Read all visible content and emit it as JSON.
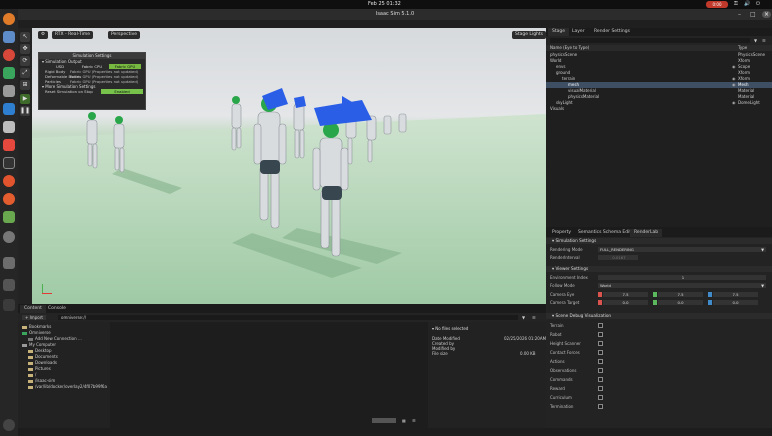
{
  "system": {
    "clock": "Feb 25 01:32",
    "rec_label": "0:00",
    "indicators": [
      "⚿",
      "🔊",
      "⏻"
    ]
  },
  "window": {
    "title": "Isaac Sim 5.1.0"
  },
  "menu": [
    "File",
    "Edit",
    "Create",
    "Window",
    "Tools",
    "Utilities",
    "Layouts",
    "Help"
  ],
  "viewport": {
    "render_mode": "RTX - Real-Time",
    "camera": "Perspective",
    "lights": "Stage Lights"
  },
  "sim_panel": {
    "title": "Simulation Settings",
    "section_output": "Simulation Output",
    "devices": [
      "USD",
      "Fabric CPU",
      "Fabric GPU"
    ],
    "selected_device": "Fabric GPU",
    "rows": [
      {
        "label": "Rigid Body",
        "value": "Fabric GPU (Properties not updated)"
      },
      {
        "label": "Deformable Bodies",
        "value": "Fabric GPU (Properties not updated)"
      },
      {
        "label": "Particles",
        "value": "Fabric GPU (Properties not updated)"
      }
    ],
    "section_more": "More Simulation Settings",
    "reset_label": "Reset Simulation on Stop",
    "reset_value": "Enabled"
  },
  "bottom": {
    "tabs": [
      "Content",
      "Console"
    ],
    "import_label": "Import",
    "path": "omniverse://",
    "tree": [
      "Bookmarks",
      "Omniverse",
      "Add New Connection ...",
      "My Computer",
      "Desktop",
      "Documents",
      "Downloads",
      "Pictures",
      "/",
      "/Isaac-sim",
      "/var/lib/docker/overlay2/4f07b99f6a"
    ],
    "info": {
      "header": "No files selected",
      "rows": [
        {
          "k": "Date Modified",
          "v": "02/25/2026 01:20AM"
        },
        {
          "k": "Created by",
          "v": ""
        },
        {
          "k": "Modified by",
          "v": ""
        },
        {
          "k": "File size",
          "v": "0.00 KB"
        }
      ]
    }
  },
  "stage": {
    "tabs": [
      "Stage",
      "Layer",
      "Render Settings"
    ],
    "col_name": "Name (Eye to Type)",
    "col_type": "Type",
    "rows": [
      {
        "name": "physicsScene",
        "type": "PhysicsScene",
        "depth": 0
      },
      {
        "name": "World",
        "type": "Xform",
        "depth": 0
      },
      {
        "name": "envs",
        "type": "Scope",
        "depth": 1
      },
      {
        "name": "ground",
        "type": "Xform",
        "depth": 1
      },
      {
        "name": "terrain",
        "type": "Xform",
        "depth": 2
      },
      {
        "name": "mesh",
        "type": "Mesh",
        "depth": 3
      },
      {
        "name": "visualMaterial",
        "type": "Material",
        "depth": 2
      },
      {
        "name": "physicsMaterial",
        "type": "Material",
        "depth": 2
      },
      {
        "name": "skyLight",
        "type": "DomeLight",
        "depth": 1
      },
      {
        "name": "Visuals",
        "type": "",
        "depth": 0
      }
    ],
    "selected_row": 5
  },
  "props": {
    "tabs": [
      "Property",
      "Semantics Schema Editor",
      "RenderLab"
    ],
    "sim_header": "Simulation Settings",
    "rendering_mode_label": "Rendering Mode",
    "rendering_mode_value": "FULL_RENDERING",
    "render_interval_label": "RenderInterval",
    "render_interval_value": "0.0167",
    "viewer_header": "Viewer Settings",
    "env_index_label": "Environment Index",
    "env_index_value": "1",
    "follow_label": "Follow Mode",
    "follow_value": "World",
    "cam_eye_label": "Camera Eye",
    "cam_eye": [
      "7.5",
      "7.5",
      "7.5"
    ],
    "cam_target_label": "Camera Target",
    "cam_target": [
      "0.0",
      "0.0",
      "0.0"
    ],
    "debug_header": "Scene Debug Visualization",
    "debug_items": [
      "Terrain",
      "Robot",
      "Height Scanner",
      "Contact Forces",
      "Actions",
      "Observations",
      "Commands",
      "Reward",
      "Curriculum",
      "Termination"
    ]
  }
}
